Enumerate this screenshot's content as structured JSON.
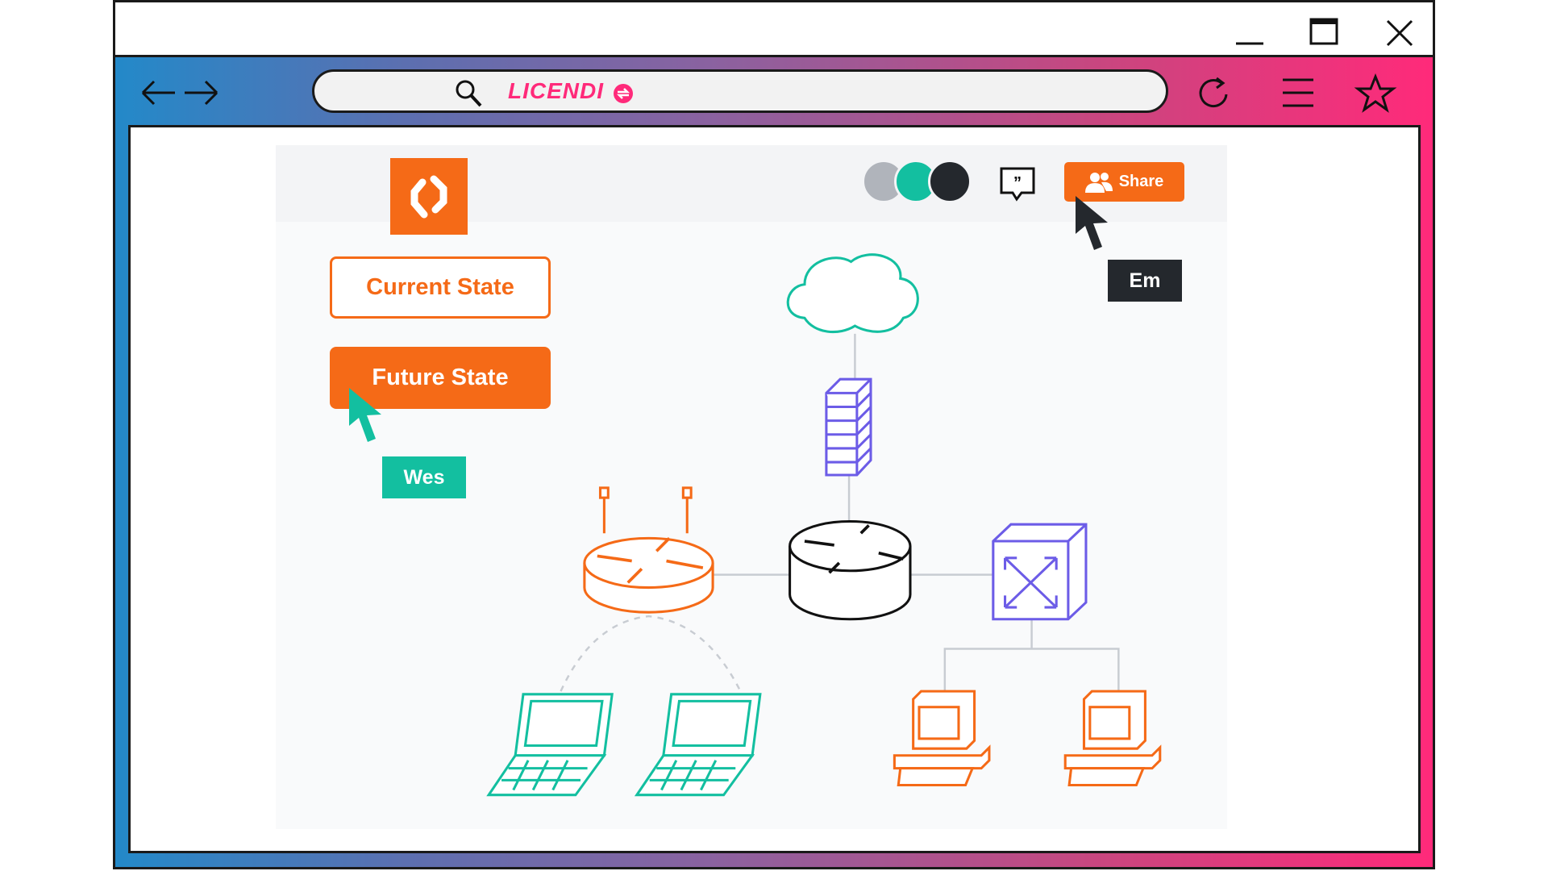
{
  "browser": {
    "window_controls": [
      "minimize-icon",
      "maximize-icon",
      "close-icon"
    ],
    "nav": [
      "back-arrow-icon",
      "forward-arrow-icon"
    ],
    "address_bar": {
      "brand_text": "LICENDI"
    },
    "toolbar_icons": [
      "reload-icon",
      "menu-icon",
      "star-icon"
    ],
    "gradient_colors": [
      "#2389c9",
      "#ff2a7a"
    ]
  },
  "app": {
    "brand_color": "#f56a17",
    "collaborators": [
      {
        "color": "#b0b4bb"
      },
      {
        "color": "#13bfa0"
      },
      {
        "color": "#24282d"
      }
    ],
    "share_label": "Share",
    "buttons": {
      "current_state": "Current State",
      "future_state": "Future State"
    },
    "cursors": [
      {
        "label": "Wes",
        "color": "#13bfa0"
      },
      {
        "label": "Em",
        "color": "#24282d"
      }
    ]
  },
  "diagram": {
    "nodes": [
      "cloud",
      "firewall",
      "core-router",
      "wireless-router",
      "switch",
      "laptop",
      "laptop",
      "desktop",
      "desktop"
    ],
    "colors": {
      "teal": "#13bfa0",
      "purple": "#6c5ce7",
      "orange": "#f56a17",
      "black": "#111111",
      "link": "#c8ccd2"
    }
  }
}
